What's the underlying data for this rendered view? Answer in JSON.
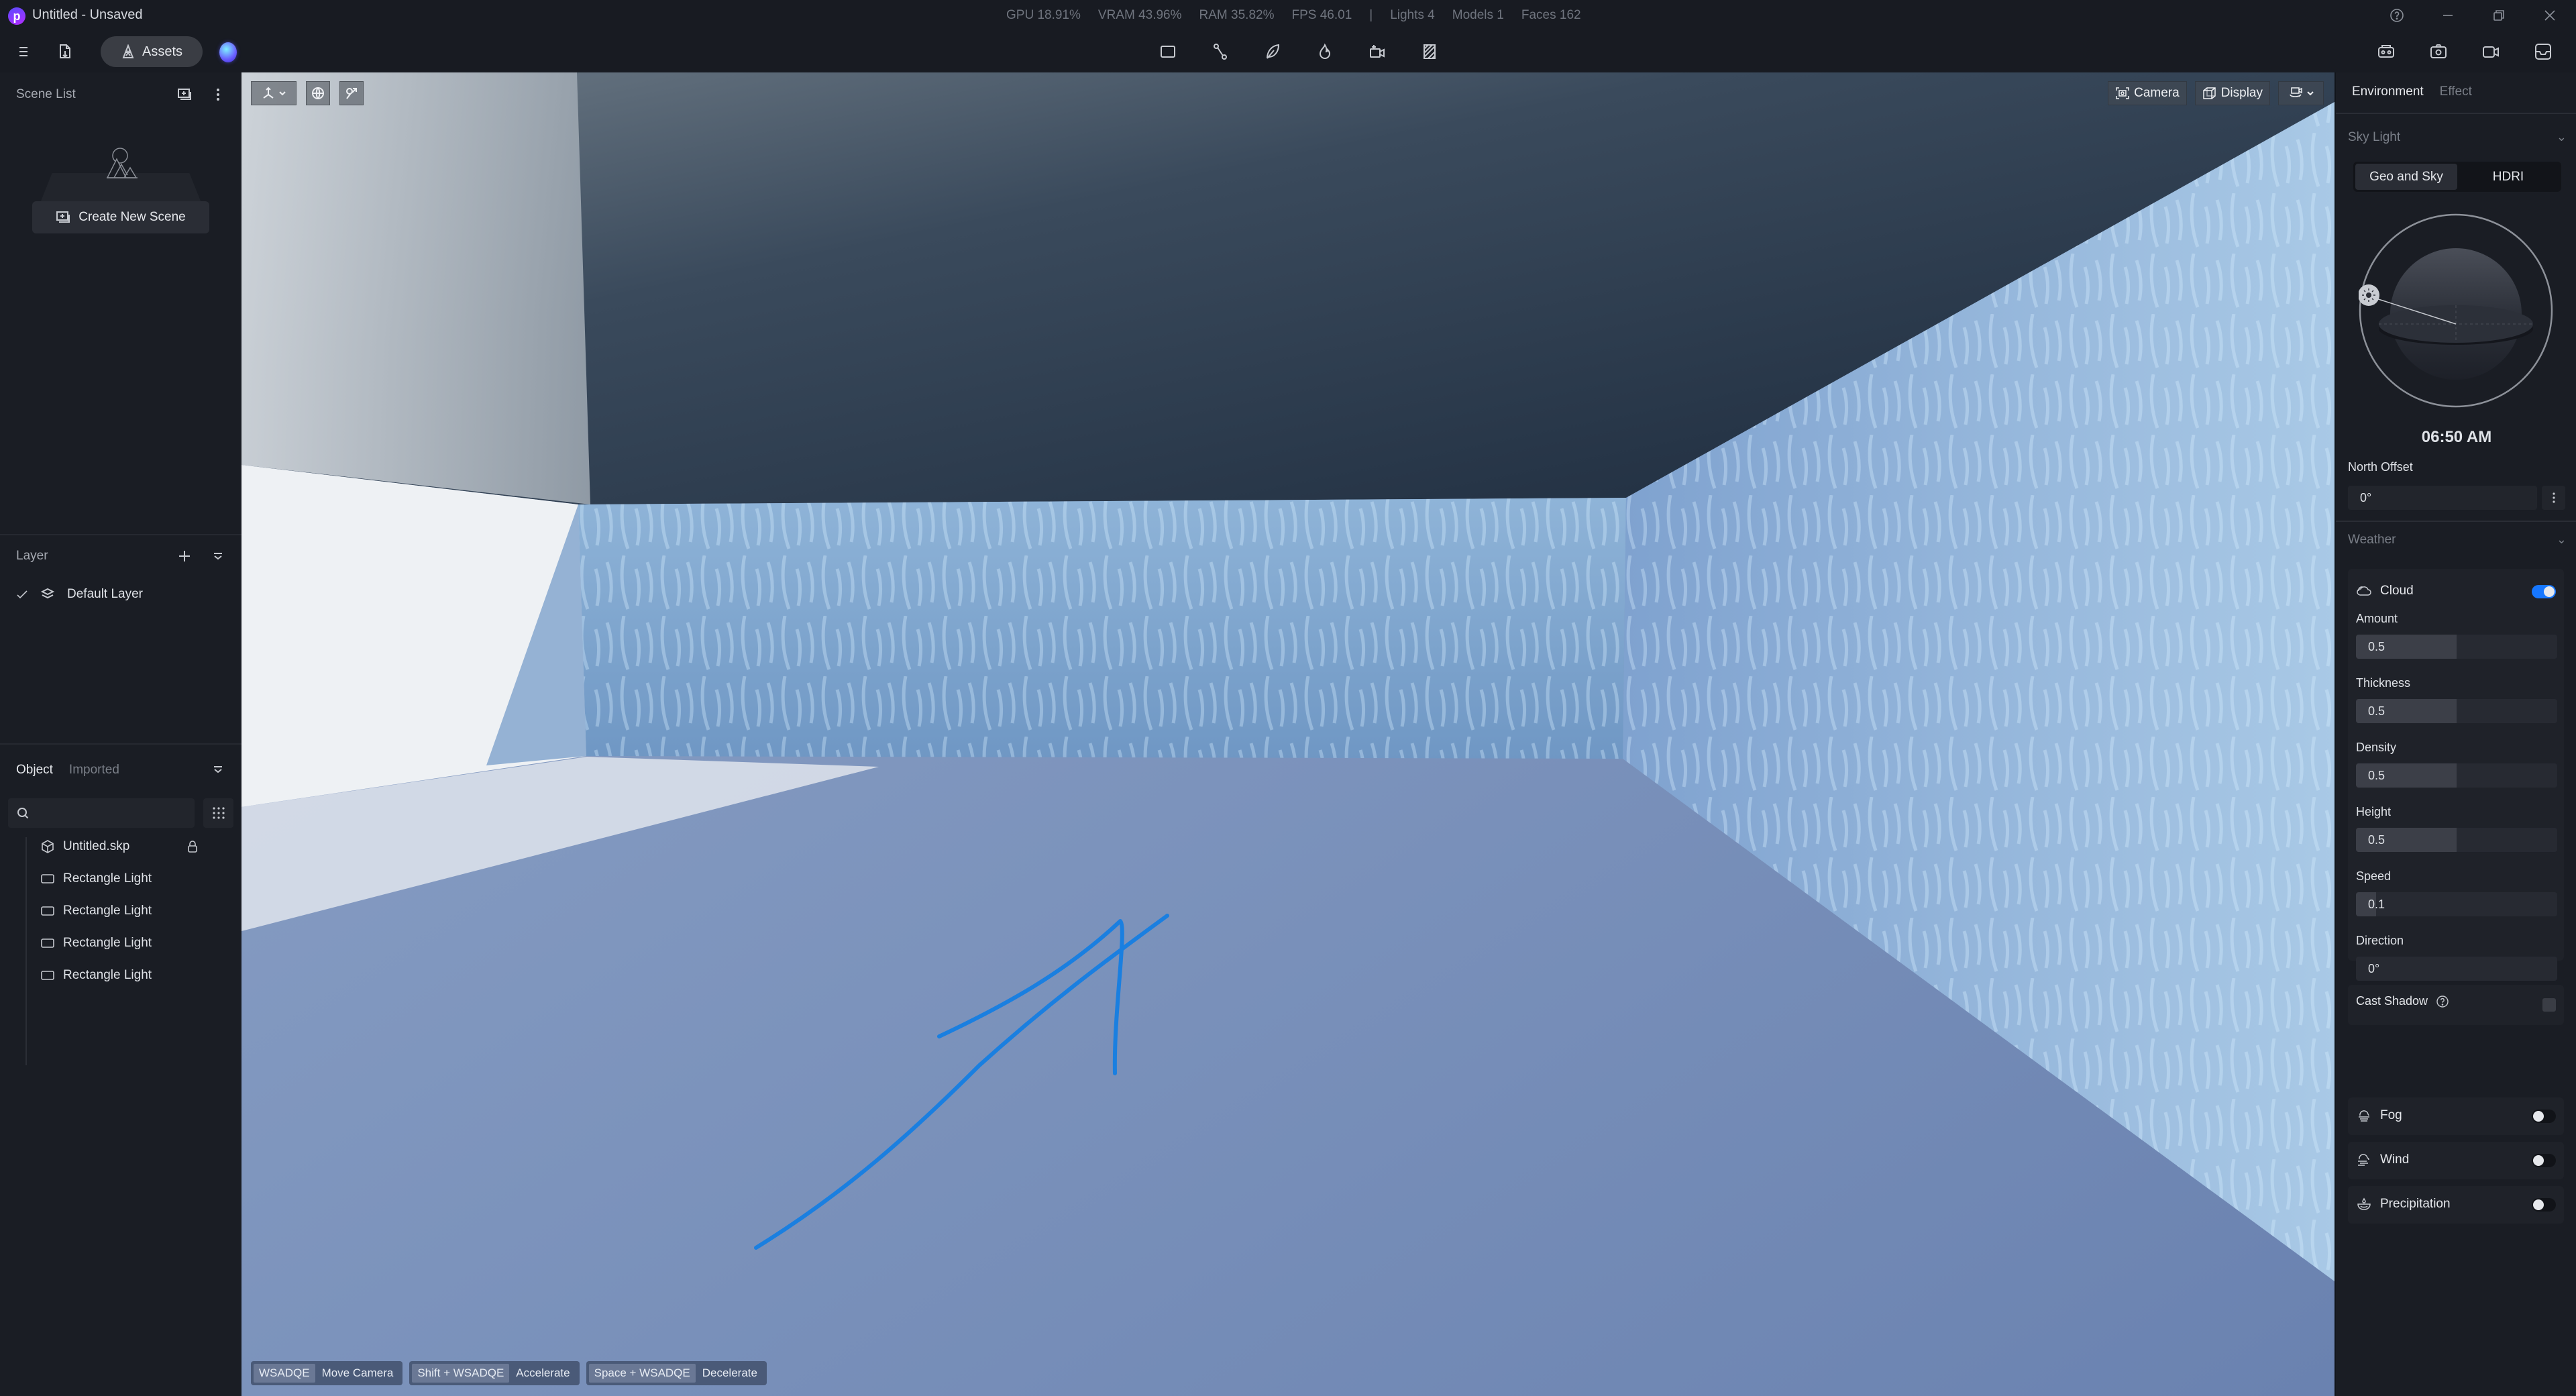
{
  "app": {
    "title": "Untitled - Unsaved",
    "logo_letter": "p"
  },
  "stats": {
    "gpu": "GPU 18.91%",
    "vram": "VRAM 43.96%",
    "ram": "RAM 35.82%",
    "fps": "FPS 46.01",
    "separator": "|",
    "lights": "Lights 4",
    "models": "Models 1",
    "faces": "Faces 162"
  },
  "toolbar": {
    "assets_label": "Assets",
    "center_tools": [
      "rectangle-tool",
      "path-tool",
      "leaf-tool",
      "fire-tool",
      "add-camera-tool",
      "hatch-tool"
    ],
    "right_tools": [
      "vr-headset",
      "screenshot-camera",
      "video-record",
      "inbox"
    ]
  },
  "scene_list": {
    "title": "Scene List",
    "create_label": "Create New Scene"
  },
  "layer": {
    "title": "Layer",
    "items": [
      {
        "label": "Default Layer",
        "checked": true
      }
    ]
  },
  "objects": {
    "tabs": [
      {
        "label": "Object",
        "active": true
      },
      {
        "label": "Imported",
        "active": false
      }
    ],
    "search_placeholder": "",
    "search_value": "",
    "items": [
      {
        "label": "Untitled.skp",
        "icon": "cube",
        "locked": true
      },
      {
        "label": "Rectangle Light",
        "icon": "rect-light",
        "locked": false
      },
      {
        "label": "Rectangle Light",
        "icon": "rect-light",
        "locked": false
      },
      {
        "label": "Rectangle Light",
        "icon": "rect-light",
        "locked": false
      },
      {
        "label": "Rectangle Light",
        "icon": "rect-light",
        "locked": false
      }
    ]
  },
  "viewport": {
    "camera_label": "Camera",
    "display_label": "Display",
    "annotation_color": "#1a7fe0",
    "hints": [
      {
        "key": "WSADQE",
        "action": "Move Camera"
      },
      {
        "key": "Shift + WSADQE",
        "action": "Accelerate"
      },
      {
        "key": "Space + WSADQE",
        "action": "Decelerate"
      }
    ]
  },
  "right_panel": {
    "tabs": [
      {
        "label": "Environment",
        "active": true
      },
      {
        "label": "Effect",
        "active": false
      }
    ],
    "sky_light": {
      "title": "Sky Light",
      "modes": [
        {
          "label": "Geo and Sky",
          "active": true
        },
        {
          "label": "HDRI",
          "active": false
        }
      ],
      "time": "06:50 AM",
      "north_offset_label": "North Offset",
      "north_offset_value": "0°"
    },
    "weather": {
      "title": "Weather",
      "cloud": {
        "label": "Cloud",
        "enabled": true,
        "params": [
          {
            "label": "Amount",
            "value": "0.5",
            "fraction": 0.5
          },
          {
            "label": "Thickness",
            "value": "0.5",
            "fraction": 0.5
          },
          {
            "label": "Density",
            "value": "0.5",
            "fraction": 0.5
          },
          {
            "label": "Height",
            "value": "0.5",
            "fraction": 0.5
          },
          {
            "label": "Speed",
            "value": "0.1",
            "fraction": 0.1
          },
          {
            "label": "Direction",
            "value": "0°",
            "fraction": 0
          }
        ],
        "cast_shadow_label": "Cast Shadow",
        "cast_shadow": false
      },
      "fog": {
        "label": "Fog",
        "enabled": false
      },
      "wind": {
        "label": "Wind",
        "enabled": false
      },
      "precipitation": {
        "label": "Precipitation",
        "enabled": false
      }
    }
  },
  "colors": {
    "accent": "#1677ff",
    "panel_bg": "#1a1d24"
  }
}
